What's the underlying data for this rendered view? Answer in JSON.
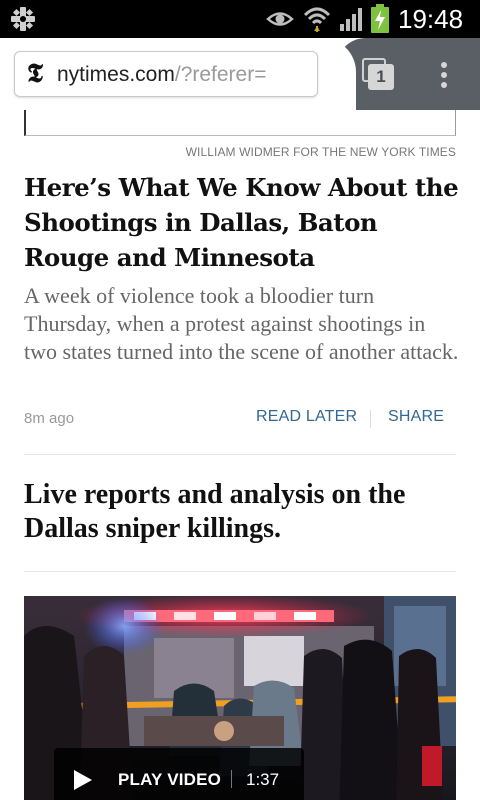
{
  "status_bar": {
    "time": "19:48",
    "icons": [
      "usb-icon",
      "eye-icon",
      "wifi-icon",
      "signal-icon",
      "battery-charging-icon"
    ]
  },
  "browser": {
    "logo": "𝕿",
    "url_host": "nytimes.com",
    "url_path": "/?referer=",
    "tab_count": "1",
    "icons": [
      "tabs-icon",
      "overflow-menu-icon"
    ]
  },
  "article": {
    "photo_credit": "WILLIAM WIDMER FOR THE NEW YORK TIMES",
    "headline": "Here’s What We Know About the Shootings in Dallas, Baton Rouge and Minnesota",
    "summary": "A week of violence took a bloodier turn Thursday, when a protest against shootings in two states turned into the scene of another attack.",
    "timestamp": "8m ago",
    "read_later": "READ LATER",
    "share": "SHARE"
  },
  "story_2": {
    "headline": "Live reports and analysis on the Dallas sniper killings."
  },
  "video": {
    "play_label": "PLAY VIDEO",
    "duration": "1:37",
    "icons": [
      "play-icon"
    ]
  },
  "colors": {
    "status_bar_bg": "#000000",
    "tab_switcher_bg": "#5a5f66",
    "link_blue": "#326891",
    "headline_text": "#111111",
    "summary_text": "#666666"
  }
}
